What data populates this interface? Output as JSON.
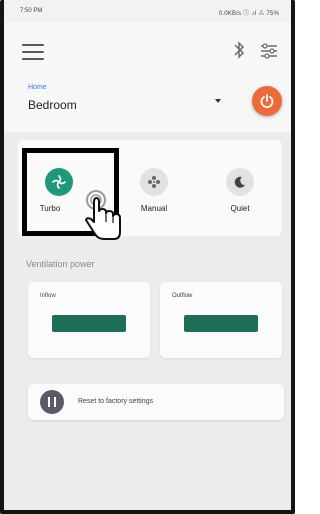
{
  "status_bar": {
    "time": "7:50 PM",
    "right_text": "0.0KB/s ⓘ .ıl ⁂ 75%"
  },
  "header": {
    "home_label": "Home",
    "room_name": "Bedroom"
  },
  "modes": {
    "items": [
      {
        "label": "Turbo",
        "icon": "turbo-icon",
        "selected": true
      },
      {
        "label": "Manual",
        "icon": "fan-icon",
        "selected": false
      },
      {
        "label": "Quiet",
        "icon": "moon-icon",
        "selected": false
      }
    ]
  },
  "ventilation": {
    "title": "Ventilation power",
    "inflow_label": "Inflow",
    "outflow_label": "Outflow"
  },
  "reset": {
    "label": "Reset to factory settings"
  },
  "colors": {
    "accent_green": "#1e9a7a",
    "power_orange": "#ef6a3a",
    "bar_green": "#1d6f5a",
    "home_blue": "#2a7ee8"
  }
}
